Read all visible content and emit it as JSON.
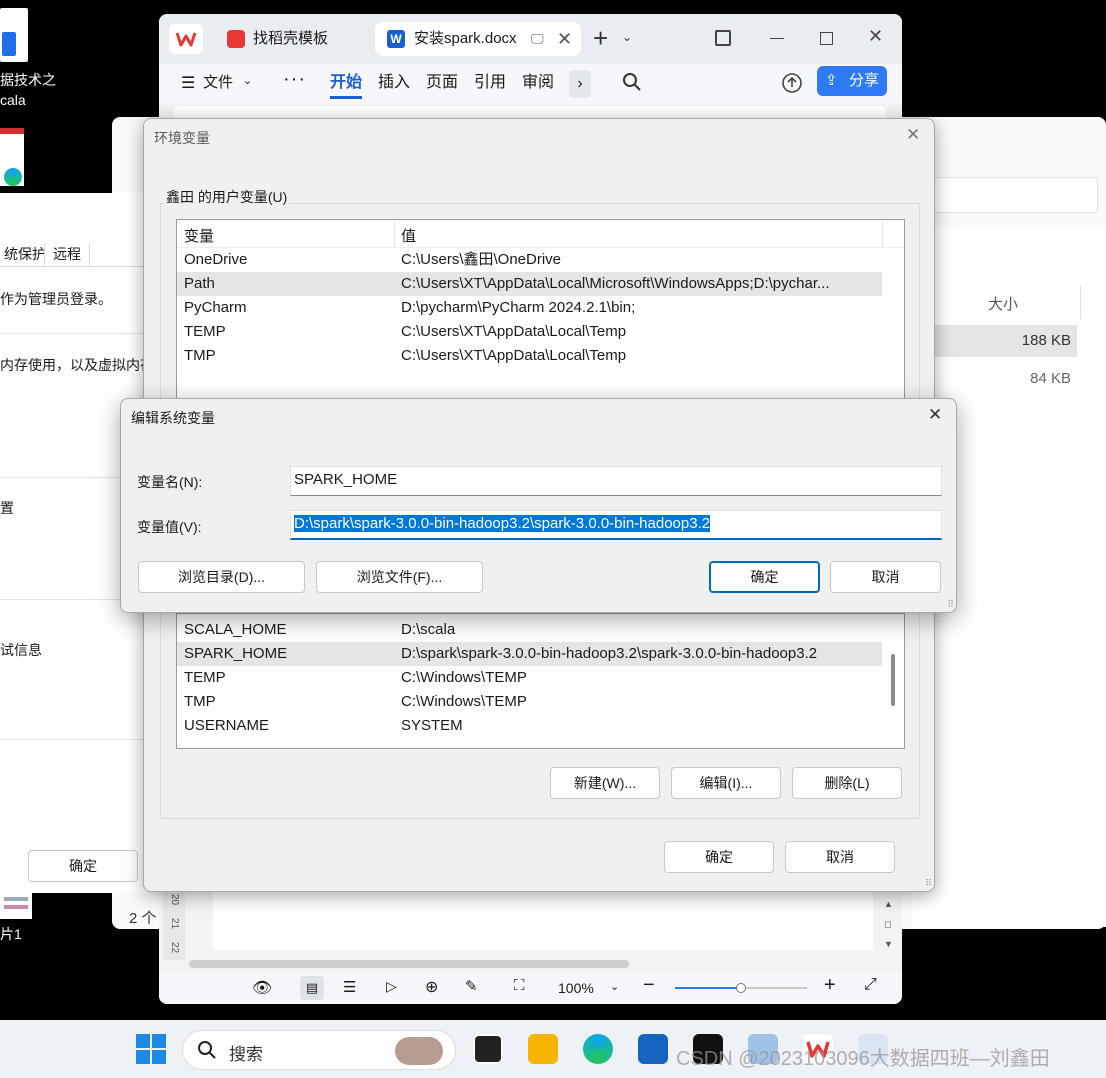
{
  "desktop": {
    "icon1_label_line1": "据技术之",
    "icon1_label_line2": "cala",
    "icon2_label": "片1"
  },
  "system_properties": {
    "tabs": [
      "统保护",
      "远程"
    ],
    "text_admin": "作为管理员登录。",
    "text_memory": "内存使用，以及虚拟内存",
    "text_settings": "置",
    "text_info": "试信息",
    "ok_label": "确定"
  },
  "wps": {
    "tabs": [
      {
        "label": "找稻壳模板"
      },
      {
        "label": "安装spark.docx"
      }
    ],
    "menu_label": "文件",
    "ribbon_items": [
      "开始",
      "插入",
      "页面",
      "引用",
      "审阅"
    ],
    "share_label": "分享",
    "zoom": "100%",
    "zoom_level": 0.5,
    "ruler_numbers": [
      "20",
      "21",
      "22"
    ]
  },
  "explorer": {
    "col_size": "大小",
    "rows": [
      {
        "size": "188 KB"
      },
      {
        "size": "84 KB"
      }
    ],
    "status_count": "2 个"
  },
  "env_dialog": {
    "title": "环境变量",
    "user_group_label": "鑫田 的用户变量(U)",
    "columns": {
      "var": "变量",
      "val": "值"
    },
    "user_vars": [
      {
        "name": "OneDrive",
        "value": "C:\\Users\\鑫田\\OneDrive"
      },
      {
        "name": "Path",
        "value": "C:\\Users\\XT\\AppData\\Local\\Microsoft\\WindowsApps;D:\\pychar..."
      },
      {
        "name": "PyCharm",
        "value": "D:\\pycharm\\PyCharm 2024.2.1\\bin;"
      },
      {
        "name": "TEMP",
        "value": "C:\\Users\\XT\\AppData\\Local\\Temp"
      },
      {
        "name": "TMP",
        "value": "C:\\Users\\XT\\AppData\\Local\\Temp"
      }
    ],
    "system_vars": [
      {
        "name": "SCALA_HOME",
        "value": "D:\\scala"
      },
      {
        "name": "SPARK_HOME",
        "value": "D:\\spark\\spark-3.0.0-bin-hadoop3.2\\spark-3.0.0-bin-hadoop3.2"
      },
      {
        "name": "TEMP",
        "value": "C:\\Windows\\TEMP"
      },
      {
        "name": "TMP",
        "value": "C:\\Windows\\TEMP"
      },
      {
        "name": "USERNAME",
        "value": "SYSTEM"
      }
    ],
    "new_label": "新建(W)...",
    "edit_label": "编辑(I)...",
    "delete_label": "删除(L)",
    "ok_label": "确定",
    "cancel_label": "取消"
  },
  "edit_dialog": {
    "title": "编辑系统变量",
    "name_label": "变量名(N):",
    "name_value": "SPARK_HOME",
    "value_label": "变量值(V):",
    "value_value": "D:\\spark\\spark-3.0.0-bin-hadoop3.2\\spark-3.0.0-bin-hadoop3.2",
    "browse_dir_label": "浏览目录(D)...",
    "browse_file_label": "浏览文件(F)...",
    "ok_label": "确定",
    "cancel_label": "取消"
  },
  "taskbar": {
    "search_placeholder": "搜索",
    "watermark": "CSDN @2023103096大数据四班—刘鑫田"
  },
  "colors": {
    "accent": "#0067c0",
    "selection": "#0078d7",
    "wps_share": "#2f7bf5"
  }
}
